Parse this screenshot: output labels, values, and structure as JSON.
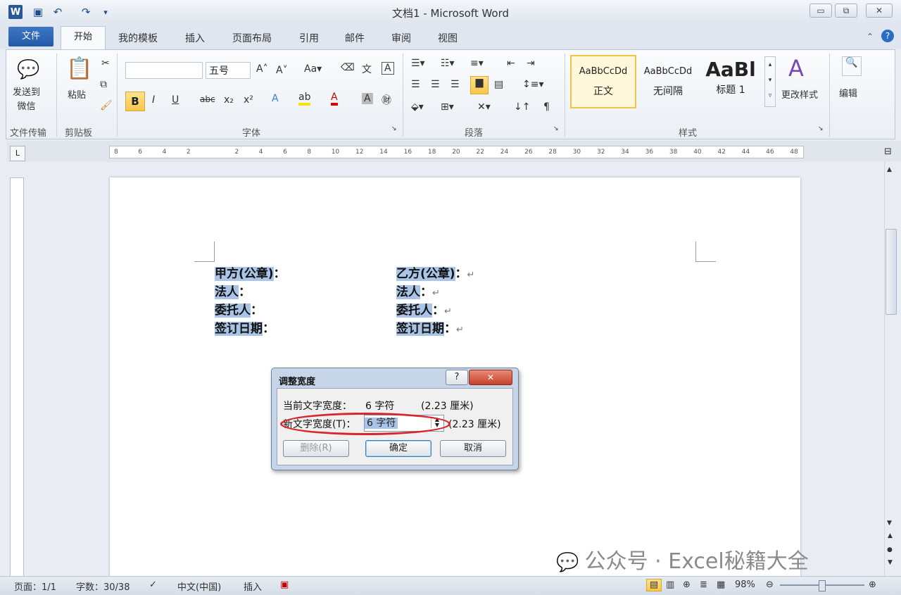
{
  "titlebar": {
    "title": "文档1 - Microsoft Word",
    "minimize": "▭",
    "restore": "⧉",
    "close": "✕"
  },
  "tabs": [
    "文件",
    "开始",
    "我的模板",
    "插入",
    "页面布局",
    "引用",
    "邮件",
    "审阅",
    "视图"
  ],
  "ribbon": {
    "share": {
      "label": "发送到\n微信",
      "group": "文件传输"
    },
    "clipboard": {
      "paste": "粘贴",
      "group": "剪贴板"
    },
    "font": {
      "name": "",
      "size": "五号",
      "group": "字体"
    },
    "paragraph": {
      "group": "段落"
    },
    "styles": {
      "normal_preview": "AaBbCcDd",
      "normal_label": "正文",
      "nospacing_preview": "AaBbCcDd",
      "nospacing_label": "无间隔",
      "heading_preview": "AaBl",
      "heading_label": "标题 1",
      "change": "更改样式",
      "group": "样式"
    },
    "edit": {
      "label": "编辑"
    }
  },
  "ruler_ticks": [
    "8",
    "6",
    "4",
    "2",
    "",
    "2",
    "4",
    "6",
    "8",
    "10",
    "12",
    "14",
    "16",
    "18",
    "20",
    "22",
    "24",
    "26",
    "28",
    "30",
    "32",
    "34",
    "36",
    "38",
    "40",
    "42",
    "44",
    "46",
    "48"
  ],
  "document": {
    "left": [
      "甲方(公章)",
      "法人",
      "委托人",
      "签订日期"
    ],
    "right": [
      "乙方(公章)",
      "法人",
      "委托人",
      "签订日期"
    ],
    "colon": "：",
    "pmark": "↵"
  },
  "dialog": {
    "title": "调整宽度",
    "help": "?",
    "close": "✕",
    "current_label": "当前文字宽度：",
    "current_value": "6 字符",
    "current_cm": "(2.23 厘米)",
    "new_label": "新文字宽度(T)：",
    "new_value": "6 字符",
    "new_cm": "(2.23 厘米)",
    "delete": "删除(R)",
    "ok": "确定",
    "cancel": "取消"
  },
  "statusbar": {
    "page": "页面：1/1",
    "words": "字数：30/38",
    "lang": "中文(中国)",
    "mode": "插入",
    "zoom": "98%"
  },
  "watermark": "公众号 · Excel秘籍大全",
  "colors": {
    "accent": "#2b5797",
    "selection": "#a9c4e6",
    "oval": "#d9262a"
  }
}
